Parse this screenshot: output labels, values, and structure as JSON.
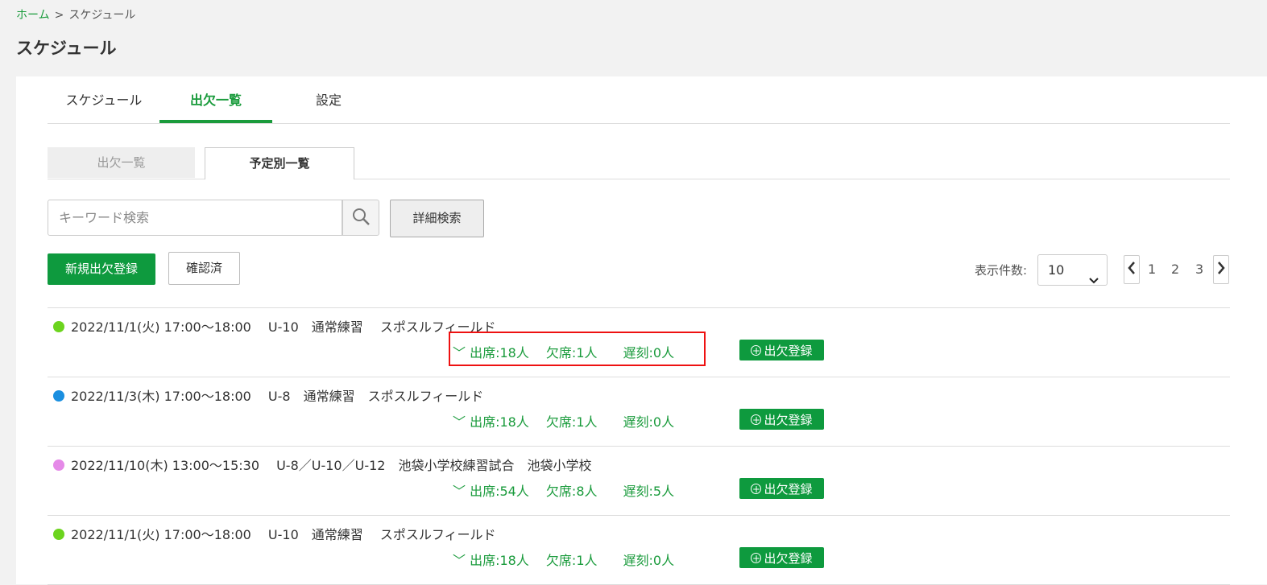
{
  "breadcrumb": {
    "home": "ホーム",
    "separator": ">",
    "current": "スケジュール"
  },
  "page_title": "スケジュール",
  "tabs": [
    {
      "label": "スケジュール",
      "active": false
    },
    {
      "label": "出欠一覧",
      "active": true
    },
    {
      "label": "設定",
      "active": false
    }
  ],
  "subtabs": [
    {
      "label": "出欠一覧",
      "active": false
    },
    {
      "label": "予定別一覧",
      "active": true
    }
  ],
  "search": {
    "placeholder": "キーワード検索",
    "value": "",
    "advanced_label": "詳細検索"
  },
  "toolbar": {
    "new_label": "新規出欠登録",
    "confirmed_label": "確認済"
  },
  "display": {
    "count_label": "表示件数:",
    "count_value": "10"
  },
  "pagination": {
    "pages": [
      "1",
      "2",
      "3"
    ]
  },
  "colors": {
    "accent": "#0e9a3e",
    "highlight": "#e11111"
  },
  "events": [
    {
      "color": "#6cd41e",
      "info": "2022/11/1(火) 17:00〜18:00　 U-10　通常練習　 スポスルフィールド",
      "stats": "﹀ 出席:18人　 欠席:1人　　遅刻:0人",
      "button": "出欠登録"
    },
    {
      "color": "#1a8fe0",
      "info": "2022/11/3(木) 17:00〜18:00　 U-8　通常練習　スポスルフィールド",
      "stats": "﹀ 出席:18人　 欠席:1人　　遅刻:0人",
      "button": "出欠登録"
    },
    {
      "color": "#e58ae8",
      "info": "2022/11/10(木) 13:00〜15:30　 U-8／U-10／U-12　池袋小学校練習試合　池袋小学校",
      "stats": "﹀ 出席:54人　 欠席:8人　　遅刻:5人",
      "button": "出欠登録"
    },
    {
      "color": "#6cd41e",
      "info": "2022/11/1(火) 17:00〜18:00　 U-10　通常練習　 スポスルフィールド",
      "stats": "﹀ 出席:18人　 欠席:1人　　遅刻:0人",
      "button": "出欠登録"
    }
  ]
}
